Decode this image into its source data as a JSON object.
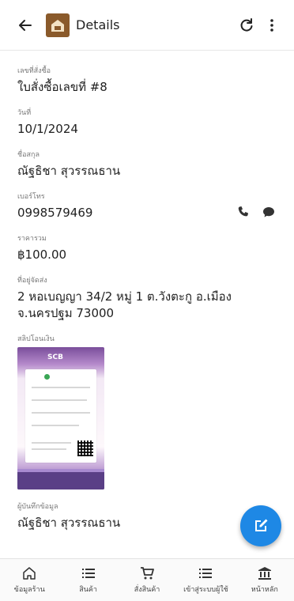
{
  "header": {
    "title": "Details",
    "back_icon": "arrow-left-icon",
    "refresh_icon": "refresh-icon",
    "menu_icon": "more-vertical-icon"
  },
  "order": {
    "number_label": "เลขที่สั่งซื้อ",
    "number_value": "ใบสั่งซื้อเลขที่ #8",
    "date_label": "วันที่",
    "date_value": "10/1/2024",
    "name_label": "ชื่อสกุล",
    "name_value": "ณัฐธิชา สุวรรณธาน",
    "phone_label": "เบอร์โทร",
    "phone_value": "0998579469",
    "total_label": "ราคารวม",
    "total_value": "฿100.00",
    "address_label": "ที่อยู่จัดส่ง",
    "address_value": "2 หอเบญญา 34/2 หมู่ 1 ต.วังตะกู อ.เมือง จ.นครปฐม 73000",
    "slip_label": "สลิปโอนเงิน",
    "slip_bank": "SCB",
    "recorder_label": "ผู้บันทึกข้อมูล",
    "recorder_value": "ณัฐธิชา สุวรรณธาน"
  },
  "bottom_nav": [
    {
      "label": "ข้อมูลร้าน",
      "icon": "home-icon"
    },
    {
      "label": "สินค้า",
      "icon": "list-icon"
    },
    {
      "label": "สั่งสินค้า",
      "icon": "cart-icon"
    },
    {
      "label": "เข้าสู่ระบบผู้ใช้",
      "icon": "list-icon"
    },
    {
      "label": "หน้าหลัก",
      "icon": "bank-icon"
    }
  ],
  "colors": {
    "fab": "#1e88e5",
    "logo": "#8a5a2b"
  }
}
